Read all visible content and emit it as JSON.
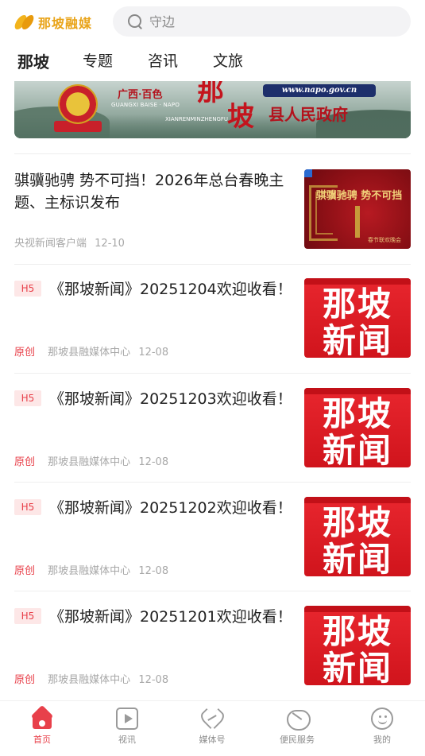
{
  "header": {
    "logo_text": "那坡融媒",
    "search_placeholder": "守边"
  },
  "tabs": [
    {
      "label": "那坡",
      "active": true
    },
    {
      "label": "专题",
      "active": false
    },
    {
      "label": "咨讯",
      "active": false
    },
    {
      "label": "文旅",
      "active": false
    }
  ],
  "banner": {
    "region": "广西·百色",
    "pinyin_1": "GUANGXI BAISE · NAPO",
    "pinyin_2": "XIANRENMINZHENGFU",
    "big_1": "那",
    "big_2": "坡",
    "url": "www.napo.gov.cn",
    "gov": "县人民政府"
  },
  "articles": [
    {
      "title": "骐骥驰骋 势不可挡！2026年总台春晚主题、主标识发布",
      "tag": "",
      "original": "",
      "source": "央视新闻客户端",
      "date": "12-10",
      "thumb_caption": "骐骥驰骋 势不可挡",
      "thumb_sub": "春节联欢晚会"
    },
    {
      "title": "《那坡新闻》20251204欢迎收看！",
      "tag": "H5",
      "original": "原创",
      "source": "那坡县融媒体中心",
      "date": "12-08",
      "thumb_line1": "那坡",
      "thumb_line2": "新闻"
    },
    {
      "title": "《那坡新闻》20251203欢迎收看！",
      "tag": "H5",
      "original": "原创",
      "source": "那坡县融媒体中心",
      "date": "12-08",
      "thumb_line1": "那坡",
      "thumb_line2": "新闻"
    },
    {
      "title": "《那坡新闻》20251202欢迎收看！",
      "tag": "H5",
      "original": "原创",
      "source": "那坡县融媒体中心",
      "date": "12-08",
      "thumb_line1": "那坡",
      "thumb_line2": "新闻"
    },
    {
      "title": "《那坡新闻》20251201欢迎收看！",
      "tag": "H5",
      "original": "原创",
      "source": "那坡县融媒体中心",
      "date": "12-08",
      "thumb_line1": "那坡",
      "thumb_line2": "新闻"
    }
  ],
  "bottom_nav": [
    {
      "label": "首页",
      "icon": "home-icon",
      "active": true
    },
    {
      "label": "视讯",
      "icon": "video-icon",
      "active": false
    },
    {
      "label": "媒体号",
      "icon": "media-icon",
      "active": false
    },
    {
      "label": "便民服务",
      "icon": "service-icon",
      "active": false
    },
    {
      "label": "我的",
      "icon": "me-icon",
      "active": false
    }
  ],
  "colors": {
    "accent": "#e8404a",
    "logo": "#e9a41a"
  }
}
